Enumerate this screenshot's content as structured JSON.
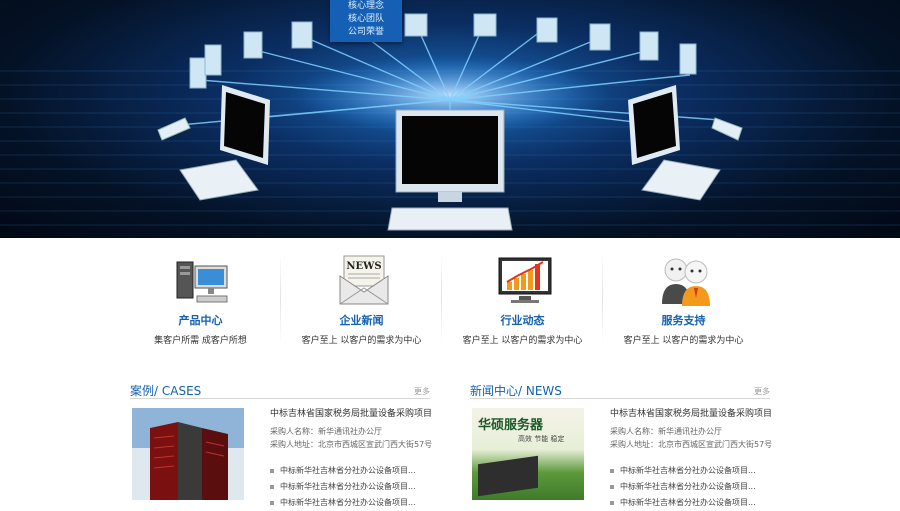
{
  "dropdown": {
    "items": [
      "核心理念",
      "核心团队",
      "公司荣誉"
    ]
  },
  "services": [
    {
      "title": "产品中心",
      "desc": "集客户所需  成客户所想",
      "icon": "desktop-computer-icon"
    },
    {
      "title": "企业新闻",
      "desc": "客户至上  以客户的需求为中心",
      "icon": "news-envelope-icon"
    },
    {
      "title": "行业动态",
      "desc": "客户至上  以客户的需求为中心",
      "icon": "bar-chart-monitor-icon"
    },
    {
      "title": "服务支持",
      "desc": "客户至上  以客户的需求为中心",
      "icon": "support-people-icon"
    }
  ],
  "cases": {
    "title": "案例/  CASES",
    "more": "更多",
    "headline": "中标吉林省国家税务局批量设备采购项目",
    "meta1": "采购人名称：新华通讯社办公厅",
    "meta2": "采购人地址：北京市西城区宣武门西大街57号",
    "items": [
      "中标新华社吉林省分社办公设备项目...",
      "中标新华社吉林省分社办公设备项目...",
      "中标新华社吉林省分社办公设备项目..."
    ]
  },
  "news": {
    "title": "新闻中心/  NEWS",
    "more": "更多",
    "banner": "华硕服务器",
    "banner_sub": "高效 节能 稳定",
    "headline": "中标吉林省国家税务局批量设备采购项目",
    "meta1": "采购人名称：新华通讯社办公厅",
    "meta2": "采购人地址：北京市西城区宣武门西大街57号",
    "items": [
      "中标新华社吉林省分社办公设备项目...",
      "中标新华社吉林省分社办公设备项目...",
      "中标新华社吉林省分社办公设备项目..."
    ]
  },
  "colors": {
    "accent": "#1561b2",
    "hero_dark": "#041226"
  }
}
